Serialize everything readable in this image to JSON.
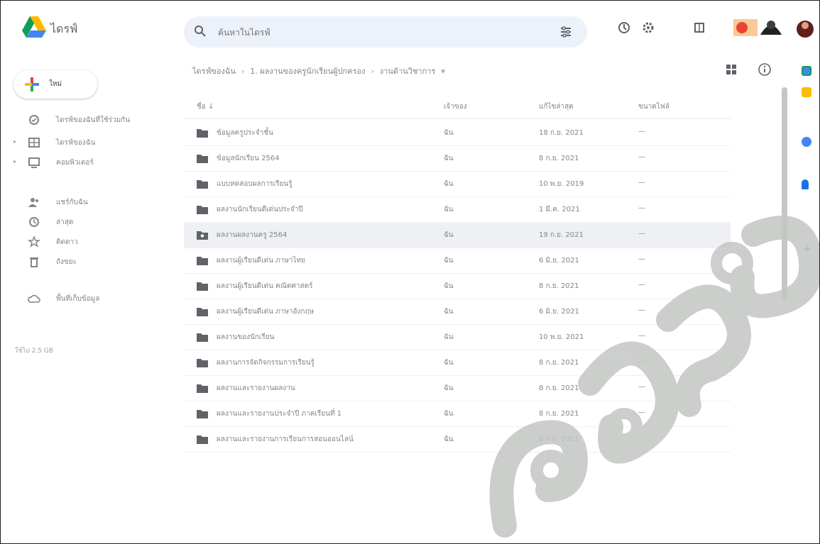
{
  "app": {
    "name": "ไดรฟ์"
  },
  "search": {
    "placeholder": "ค้นหาในไดรฟ์"
  },
  "sidebar": {
    "new_label": "ใหม่",
    "items": [
      {
        "label": "ไดรฟ์ของฉันที่ใช้ร่วมกัน",
        "icon": "priority-icon"
      },
      {
        "label": "ไดรฟ์ของฉัน",
        "icon": "my-drive-icon"
      },
      {
        "label": "คอมพิวเตอร์",
        "icon": "computers-icon"
      },
      {
        "label": "แชร์กับฉัน",
        "icon": "shared-icon"
      },
      {
        "label": "ล่าสุด",
        "icon": "recent-icon"
      },
      {
        "label": "ติดดาว",
        "icon": "star-icon"
      },
      {
        "label": "ถังขยะ",
        "icon": "trash-icon"
      },
      {
        "label": "พื้นที่เก็บข้อมูล",
        "icon": "cloud-icon"
      }
    ],
    "storage_text": "ใช้ไป 2.5 GB"
  },
  "breadcrumb": {
    "items": [
      "ไดรฟ์ของฉัน",
      "1. ผลงานของครูนักเรียนผู้ปกครอง",
      "งานด้านวิชาการ"
    ]
  },
  "table": {
    "headers": {
      "name": "ชื่อ",
      "owner": "เจ้าของ",
      "modified": "แก้ไขล่าสุด",
      "size": "ขนาดไฟล์"
    },
    "rows": [
      {
        "name": "ข้อมูลครูประจำชั้น",
        "owner": "ฉัน",
        "modified": "18 ก.ย. 2021",
        "size": "—",
        "shared": false
      },
      {
        "name": "ข้อมูลนักเรียน 2564",
        "owner": "ฉัน",
        "modified": "8 ก.ย. 2021",
        "size": "—",
        "shared": false
      },
      {
        "name": "แบบทดสอบผลการเรียนรู้",
        "owner": "ฉัน",
        "modified": "10 พ.ย. 2019",
        "size": "—",
        "shared": false
      },
      {
        "name": "ผลงานนักเรียนดีเด่นประจำปี",
        "owner": "ฉัน",
        "modified": "1 มี.ค. 2021",
        "size": "—",
        "shared": false
      },
      {
        "name": "ผลงานผลงานครู 2564",
        "owner": "ฉัน",
        "modified": "19 ก.ย. 2021",
        "size": "—",
        "shared": true
      },
      {
        "name": "ผลงานผู้เรียนดีเด่น ภาษาไทย",
        "owner": "ฉัน",
        "modified": "6 มิ.ย. 2021",
        "size": "—",
        "shared": false
      },
      {
        "name": "ผลงานผู้เรียนดีเด่น คณิตศาสตร์",
        "owner": "ฉัน",
        "modified": "8 ก.ย. 2021",
        "size": "—",
        "shared": false
      },
      {
        "name": "ผลงานผู้เรียนดีเด่น ภาษาอังกฤษ",
        "owner": "ฉัน",
        "modified": "6 มิ.ย. 2021",
        "size": "—",
        "shared": false
      },
      {
        "name": "ผลงานของนักเรียน",
        "owner": "ฉัน",
        "modified": "10 พ.ย. 2021",
        "size": "—",
        "shared": false
      },
      {
        "name": "ผลงานการจัดกิจกรรมการเรียนรู้",
        "owner": "ฉัน",
        "modified": "8 ก.ย. 2021",
        "size": "—",
        "shared": false
      },
      {
        "name": "ผลงานและรายงานผลงาน",
        "owner": "ฉัน",
        "modified": "8 ก.ย. 2021",
        "size": "—",
        "shared": false
      },
      {
        "name": "ผลงานและรายงานประจำปี ภาคเรียนที่ 1",
        "owner": "ฉัน",
        "modified": "8 ก.ย. 2021",
        "size": "—",
        "shared": false
      },
      {
        "name": "ผลงานและรายงานการเรียนการสอนออนไลน์",
        "owner": "ฉัน",
        "modified": "8 ก.ย. 2021",
        "size": "—",
        "shared": false
      }
    ]
  },
  "colors": {
    "accent": "#1a73e8",
    "folder": "#5f6368",
    "selected_row": "#eef0f3",
    "watermark": "#c4c7c5"
  }
}
